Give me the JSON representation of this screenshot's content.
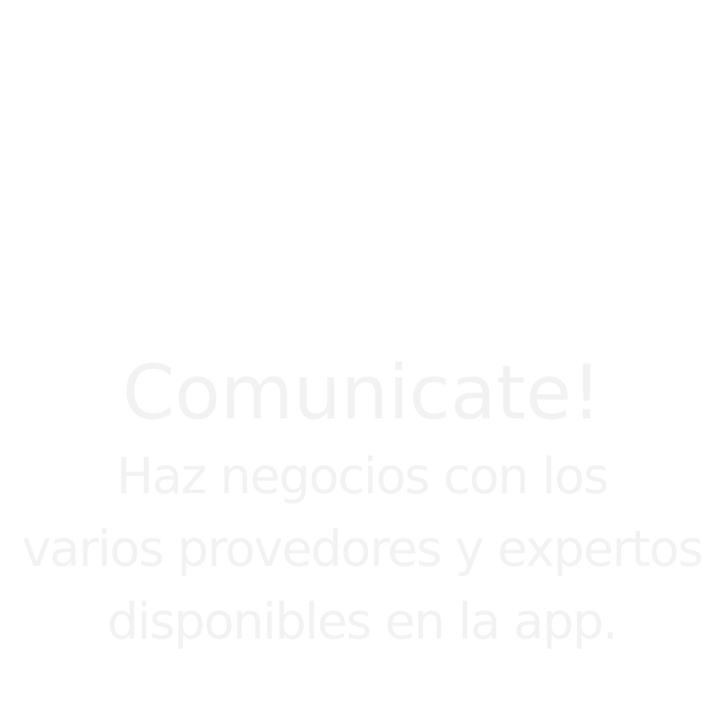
{
  "onboarding": {
    "title": "Comunicate!",
    "subtitle_lines": [
      "Haz negocios con los",
      "varios provedores y expertos",
      "disponibles en la app."
    ],
    "text_color": "#f2f2f2",
    "background_color": "#ffffff"
  }
}
